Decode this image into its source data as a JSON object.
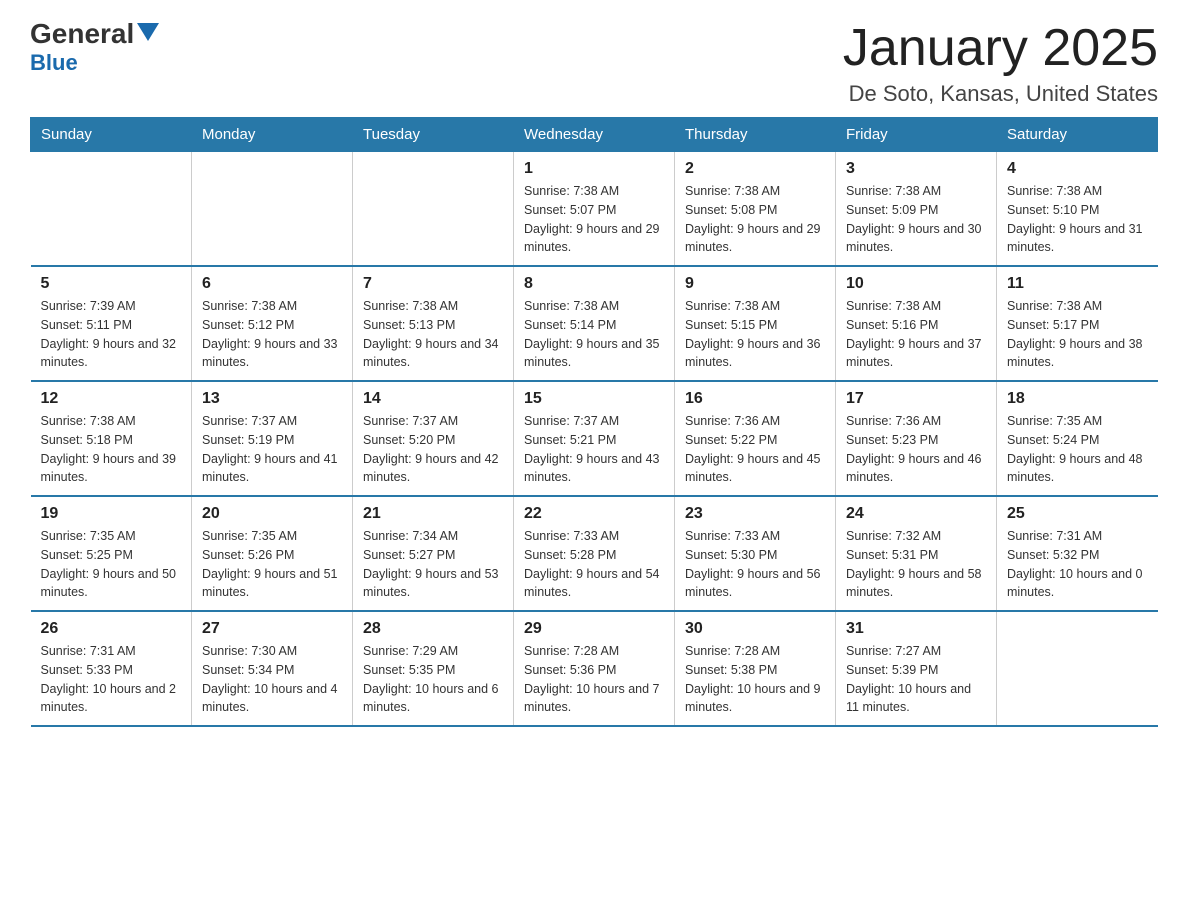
{
  "logo": {
    "general": "General",
    "blue": "Blue"
  },
  "title": "January 2025",
  "subtitle": "De Soto, Kansas, United States",
  "days_of_week": [
    "Sunday",
    "Monday",
    "Tuesday",
    "Wednesday",
    "Thursday",
    "Friday",
    "Saturday"
  ],
  "weeks": [
    [
      {
        "day": "",
        "info": ""
      },
      {
        "day": "",
        "info": ""
      },
      {
        "day": "",
        "info": ""
      },
      {
        "day": "1",
        "info": "Sunrise: 7:38 AM\nSunset: 5:07 PM\nDaylight: 9 hours and 29 minutes."
      },
      {
        "day": "2",
        "info": "Sunrise: 7:38 AM\nSunset: 5:08 PM\nDaylight: 9 hours and 29 minutes."
      },
      {
        "day": "3",
        "info": "Sunrise: 7:38 AM\nSunset: 5:09 PM\nDaylight: 9 hours and 30 minutes."
      },
      {
        "day": "4",
        "info": "Sunrise: 7:38 AM\nSunset: 5:10 PM\nDaylight: 9 hours and 31 minutes."
      }
    ],
    [
      {
        "day": "5",
        "info": "Sunrise: 7:39 AM\nSunset: 5:11 PM\nDaylight: 9 hours and 32 minutes."
      },
      {
        "day": "6",
        "info": "Sunrise: 7:38 AM\nSunset: 5:12 PM\nDaylight: 9 hours and 33 minutes."
      },
      {
        "day": "7",
        "info": "Sunrise: 7:38 AM\nSunset: 5:13 PM\nDaylight: 9 hours and 34 minutes."
      },
      {
        "day": "8",
        "info": "Sunrise: 7:38 AM\nSunset: 5:14 PM\nDaylight: 9 hours and 35 minutes."
      },
      {
        "day": "9",
        "info": "Sunrise: 7:38 AM\nSunset: 5:15 PM\nDaylight: 9 hours and 36 minutes."
      },
      {
        "day": "10",
        "info": "Sunrise: 7:38 AM\nSunset: 5:16 PM\nDaylight: 9 hours and 37 minutes."
      },
      {
        "day": "11",
        "info": "Sunrise: 7:38 AM\nSunset: 5:17 PM\nDaylight: 9 hours and 38 minutes."
      }
    ],
    [
      {
        "day": "12",
        "info": "Sunrise: 7:38 AM\nSunset: 5:18 PM\nDaylight: 9 hours and 39 minutes."
      },
      {
        "day": "13",
        "info": "Sunrise: 7:37 AM\nSunset: 5:19 PM\nDaylight: 9 hours and 41 minutes."
      },
      {
        "day": "14",
        "info": "Sunrise: 7:37 AM\nSunset: 5:20 PM\nDaylight: 9 hours and 42 minutes."
      },
      {
        "day": "15",
        "info": "Sunrise: 7:37 AM\nSunset: 5:21 PM\nDaylight: 9 hours and 43 minutes."
      },
      {
        "day": "16",
        "info": "Sunrise: 7:36 AM\nSunset: 5:22 PM\nDaylight: 9 hours and 45 minutes."
      },
      {
        "day": "17",
        "info": "Sunrise: 7:36 AM\nSunset: 5:23 PM\nDaylight: 9 hours and 46 minutes."
      },
      {
        "day": "18",
        "info": "Sunrise: 7:35 AM\nSunset: 5:24 PM\nDaylight: 9 hours and 48 minutes."
      }
    ],
    [
      {
        "day": "19",
        "info": "Sunrise: 7:35 AM\nSunset: 5:25 PM\nDaylight: 9 hours and 50 minutes."
      },
      {
        "day": "20",
        "info": "Sunrise: 7:35 AM\nSunset: 5:26 PM\nDaylight: 9 hours and 51 minutes."
      },
      {
        "day": "21",
        "info": "Sunrise: 7:34 AM\nSunset: 5:27 PM\nDaylight: 9 hours and 53 minutes."
      },
      {
        "day": "22",
        "info": "Sunrise: 7:33 AM\nSunset: 5:28 PM\nDaylight: 9 hours and 54 minutes."
      },
      {
        "day": "23",
        "info": "Sunrise: 7:33 AM\nSunset: 5:30 PM\nDaylight: 9 hours and 56 minutes."
      },
      {
        "day": "24",
        "info": "Sunrise: 7:32 AM\nSunset: 5:31 PM\nDaylight: 9 hours and 58 minutes."
      },
      {
        "day": "25",
        "info": "Sunrise: 7:31 AM\nSunset: 5:32 PM\nDaylight: 10 hours and 0 minutes."
      }
    ],
    [
      {
        "day": "26",
        "info": "Sunrise: 7:31 AM\nSunset: 5:33 PM\nDaylight: 10 hours and 2 minutes."
      },
      {
        "day": "27",
        "info": "Sunrise: 7:30 AM\nSunset: 5:34 PM\nDaylight: 10 hours and 4 minutes."
      },
      {
        "day": "28",
        "info": "Sunrise: 7:29 AM\nSunset: 5:35 PM\nDaylight: 10 hours and 6 minutes."
      },
      {
        "day": "29",
        "info": "Sunrise: 7:28 AM\nSunset: 5:36 PM\nDaylight: 10 hours and 7 minutes."
      },
      {
        "day": "30",
        "info": "Sunrise: 7:28 AM\nSunset: 5:38 PM\nDaylight: 10 hours and 9 minutes."
      },
      {
        "day": "31",
        "info": "Sunrise: 7:27 AM\nSunset: 5:39 PM\nDaylight: 10 hours and 11 minutes."
      },
      {
        "day": "",
        "info": ""
      }
    ]
  ]
}
